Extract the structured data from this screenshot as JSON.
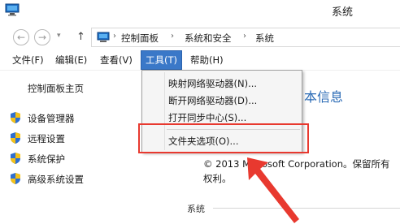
{
  "window": {
    "title": "系统"
  },
  "nav": {
    "back": "←",
    "forward": "→",
    "up": "↑"
  },
  "breadcrumb": [
    "控制面板",
    "系统和安全",
    "系统"
  ],
  "breadcrumb_separator": "›",
  "menubar": [
    {
      "label": "文件(F)"
    },
    {
      "label": "编辑(E)"
    },
    {
      "label": "查看(V)"
    },
    {
      "label": "工具(T)"
    },
    {
      "label": "帮助(H)"
    }
  ],
  "left_pane": {
    "home": "控制面板主页",
    "links": [
      "设备管理器",
      "远程设置",
      "系统保护",
      "高级系统设置"
    ]
  },
  "main": {
    "heading_fragment": "本信息",
    "copyright": "© 2013 Microsoft Corporation。保留所有权利。",
    "system_section": "系统"
  },
  "tools_menu": {
    "items": [
      "映射网络驱动器(N)...",
      "断开网络驱动器(D)...",
      "打开同步中心(S)...",
      "文件夹选项(O)..."
    ]
  },
  "colors": {
    "highlight": "#e8392f",
    "menu_selected": "#3a78c8",
    "link_heading": "#2a6ab5"
  },
  "icons": [
    "computer-icon",
    "shield-icon",
    "arrow-icon"
  ]
}
